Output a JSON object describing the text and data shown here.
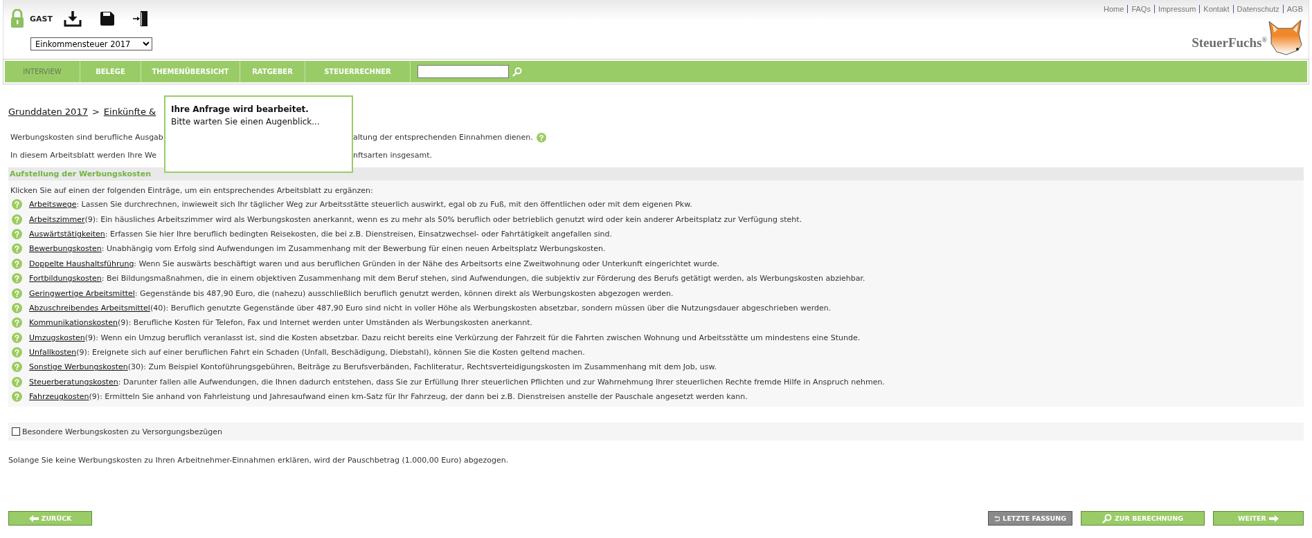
{
  "user": {
    "name": "GAST"
  },
  "tax_year_select": {
    "value": "Einkommensteuer 2017"
  },
  "top_links": [
    "Home",
    "FAQs",
    "Impressum",
    "Kontakt",
    "Datenschutz",
    "AGB"
  ],
  "logo": {
    "text": "SteuerFuchs$^{®}$"
  },
  "nav": {
    "tabs": [
      {
        "label": "INTERVIEW",
        "selected": true
      },
      {
        "label": "BELEGE",
        "selected": false
      },
      {
        "label": "THEMENÜBERSICHT",
        "selected": false
      },
      {
        "label": "RATGEBER",
        "selected": false
      },
      {
        "label": "STEUERRECHNER",
        "selected": false
      }
    ]
  },
  "breadcrumb": {
    "items": [
      "Grunddaten 2017",
      "Einkünfte &"
    ],
    "separator": ">"
  },
  "intro": [
    {
      "before": "Werbungskosten sind berufliche Ausgab",
      "after": "altung der entsprechenden Einnahmen dienen.",
      "help_icon": true
    },
    {
      "before": "In diesem Arbeitsblatt werden Ihre We",
      "after": "nftsarten insgesamt.",
      "help_icon": false
    }
  ],
  "popup": {
    "title": "Ihre Anfrage wird bearbeitet.",
    "message": "Bitte warten Sie einen Augenblick..."
  },
  "section": {
    "title": "Aufstellung der Werbungskosten",
    "instruction": "Klicken Sie auf einen der folgenden Einträge, um ein entsprechendes Arbeitsblatt zu ergänzen:",
    "items": [
      {
        "label": "Arbeitswege",
        "text": ": Lassen Sie durchrechnen, inwieweit sich Ihr täglicher Weg zur Arbeitsstätte steuerlich auswirkt, egal ob zu Fuß, mit den öffentlichen oder mit dem eigenen Pkw."
      },
      {
        "label": "Arbeitszimmer",
        "text": "(9): Ein häusliches Arbeitszimmer wird als Werbungskosten anerkannt, wenn es zu mehr als 50% beruflich oder betrieblich genutzt wird oder kein anderer Arbeitsplatz zur Verfügung steht."
      },
      {
        "label": "Auswärtstätigkeiten",
        "text": ": Erfassen Sie hier Ihre beruflich bedingten Reisekosten, die bei z.B. Dienstreisen, Einsatzwechsel- oder Fahrtätigkeit angefallen sind."
      },
      {
        "label": "Bewerbungskosten",
        "text": ": Unabhängig vom Erfolg sind Aufwendungen im Zusammenhang mit der Bewerbung für einen neuen Arbeitsplatz Werbungskosten."
      },
      {
        "label": "Doppelte Haushaltsführung",
        "text": ": Wenn Sie auswärts beschäftigt waren und aus beruflichen Gründen in der Nähe des Arbeitsorts eine Zweitwohnung oder Unterkunft eingerichtet wurde."
      },
      {
        "label": "Fortbildungskosten",
        "text": ": Bei Bildungsmaßnahmen, die in einem objektiven Zusammenhang mit dem Beruf stehen, sind Aufwendungen, die subjektiv zur Förderung des Berufs getätigt werden, als Werbungskosten abziehbar."
      },
      {
        "label": "Geringwertige Arbeitsmittel",
        "text": ": Gegenstände bis 487,90 Euro, die (nahezu) ausschließlich beruflich genutzt werden, können direkt als Werbungskosten abgezogen werden."
      },
      {
        "label": "Abzuschreibendes Arbeitsmittel",
        "text": "(40): Beruflich genutzte Gegenstände über 487,90 Euro sind nicht in voller Höhe als Werbungskosten absetzbar, sondern müssen über die Nutzungsdauer abgeschrieben werden."
      },
      {
        "label": "Kommunikationskosten",
        "text": "(9): Berufliche Kosten für Telefon, Fax und Internet werden unter Umständen als Werbungskosten anerkannt."
      },
      {
        "label": "Umzugskosten",
        "text": "(9): Wenn ein Umzug beruflich veranlasst ist, sind die Kosten absetzbar. Dazu reicht bereits eine Verkürzung der Fahrzeit für die Fahrten zwischen Wohnung und Arbeitsstätte um mindestens eine Stunde."
      },
      {
        "label": "Unfallkosten",
        "text": "(9): Ereignete sich auf einer beruflichen Fahrt ein Schaden (Unfall, Beschädigung, Diebstahl), können Sie die Kosten geltend machen."
      },
      {
        "label": "Sonstige Werbungskosten",
        "text": "(30): Zum Beispiel Kontoführungsgebühren, Beiträge zu Berufsverbänden, Fachliteratur, Rechtsverteidigungskosten im Zusammenhang mit dem Job, usw."
      },
      {
        "label": "Steuerberatungskosten",
        "text": ": Darunter fallen alle Aufwendungen, die Ihnen dadurch entstehen, dass Sie zur Erfüllung Ihrer steuerlichen Pflichten und zur Wahrnehmung Ihrer steuerlichen Rechte fremde Hilfe in Anspruch nehmen."
      },
      {
        "label": "Fahrzeugkosten",
        "text": "(9): Ermitteln Sie anhand von Fahrleistung und Jahresaufwand einen km-Satz für Ihr Fahrzeug, der dann bei z.B. Dienstreisen anstelle der Pauschale angesetzt werden kann."
      }
    ]
  },
  "checkbox": {
    "label": "Besondere Werbungskosten zu Versorgungsbezügen",
    "checked": false
  },
  "note": "Solange Sie keine Werbungskosten zu Ihren Arbeitnehmer-Einnahmen erklären, wird der Pauschbetrag (1.000,00 Euro) abgezogen.",
  "buttons": [
    {
      "label": "ZURÜCK",
      "kind": "back"
    },
    {
      "label": "LETZTE FASSUNG",
      "kind": "revert"
    },
    {
      "label": "ZUR BERECHNUNG",
      "kind": "calc"
    },
    {
      "label": "WEITER",
      "kind": "next"
    }
  ]
}
